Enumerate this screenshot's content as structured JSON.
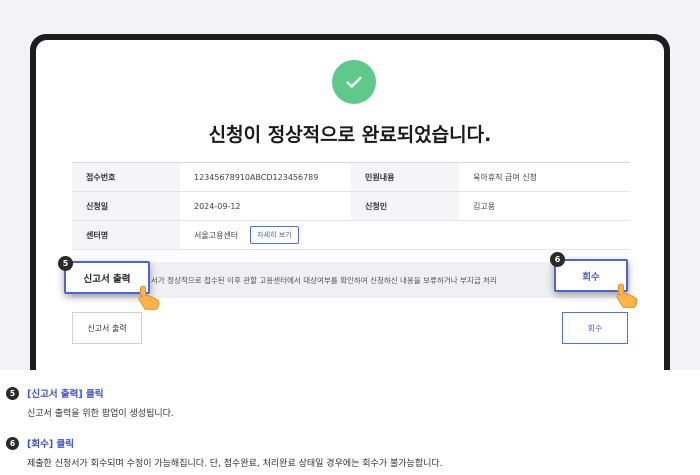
{
  "dialog": {
    "title": "신청이 정상적으로 완료되었습니다.",
    "rows": [
      {
        "label1": "접수번호",
        "value1": "12345678910ABCD123456789",
        "label2": "민원내용",
        "value2": "육아휴직 급여 신청"
      },
      {
        "label1": "신청일",
        "value1": "2024-09-12",
        "label2": "신청인",
        "value2": "김고용"
      }
    ],
    "center_label": "센터명",
    "center_value": "서울고용센터",
    "detail_button": "자세히 보기",
    "notice": "정서가 정상적으로 접수된 이후 관할 고용센터에서 대상여부를 확인하여 신청하신 내용을 보류하거나 부지급 처리",
    "print_button": "신고서 출력",
    "recall_button": "회수",
    "callout_print": "신고서 출력",
    "callout_recall": "회수",
    "badge_5": "5",
    "badge_6": "6"
  },
  "steps": [
    {
      "num": "5",
      "title": "[신고서 출력] 클릭",
      "desc": "신고서 출력을 위한 팝업이 생성됩니다."
    },
    {
      "num": "6",
      "title": "[회수] 클릭",
      "desc": "제출한 신청서가 회수되며 수정이 가능해집니다. 단, 접수완료, 처리완료 상태일 경우에는 회수가 불가능합니다."
    }
  ],
  "colors": {
    "success": "#5fc98c",
    "accent": "#4f63d9"
  }
}
